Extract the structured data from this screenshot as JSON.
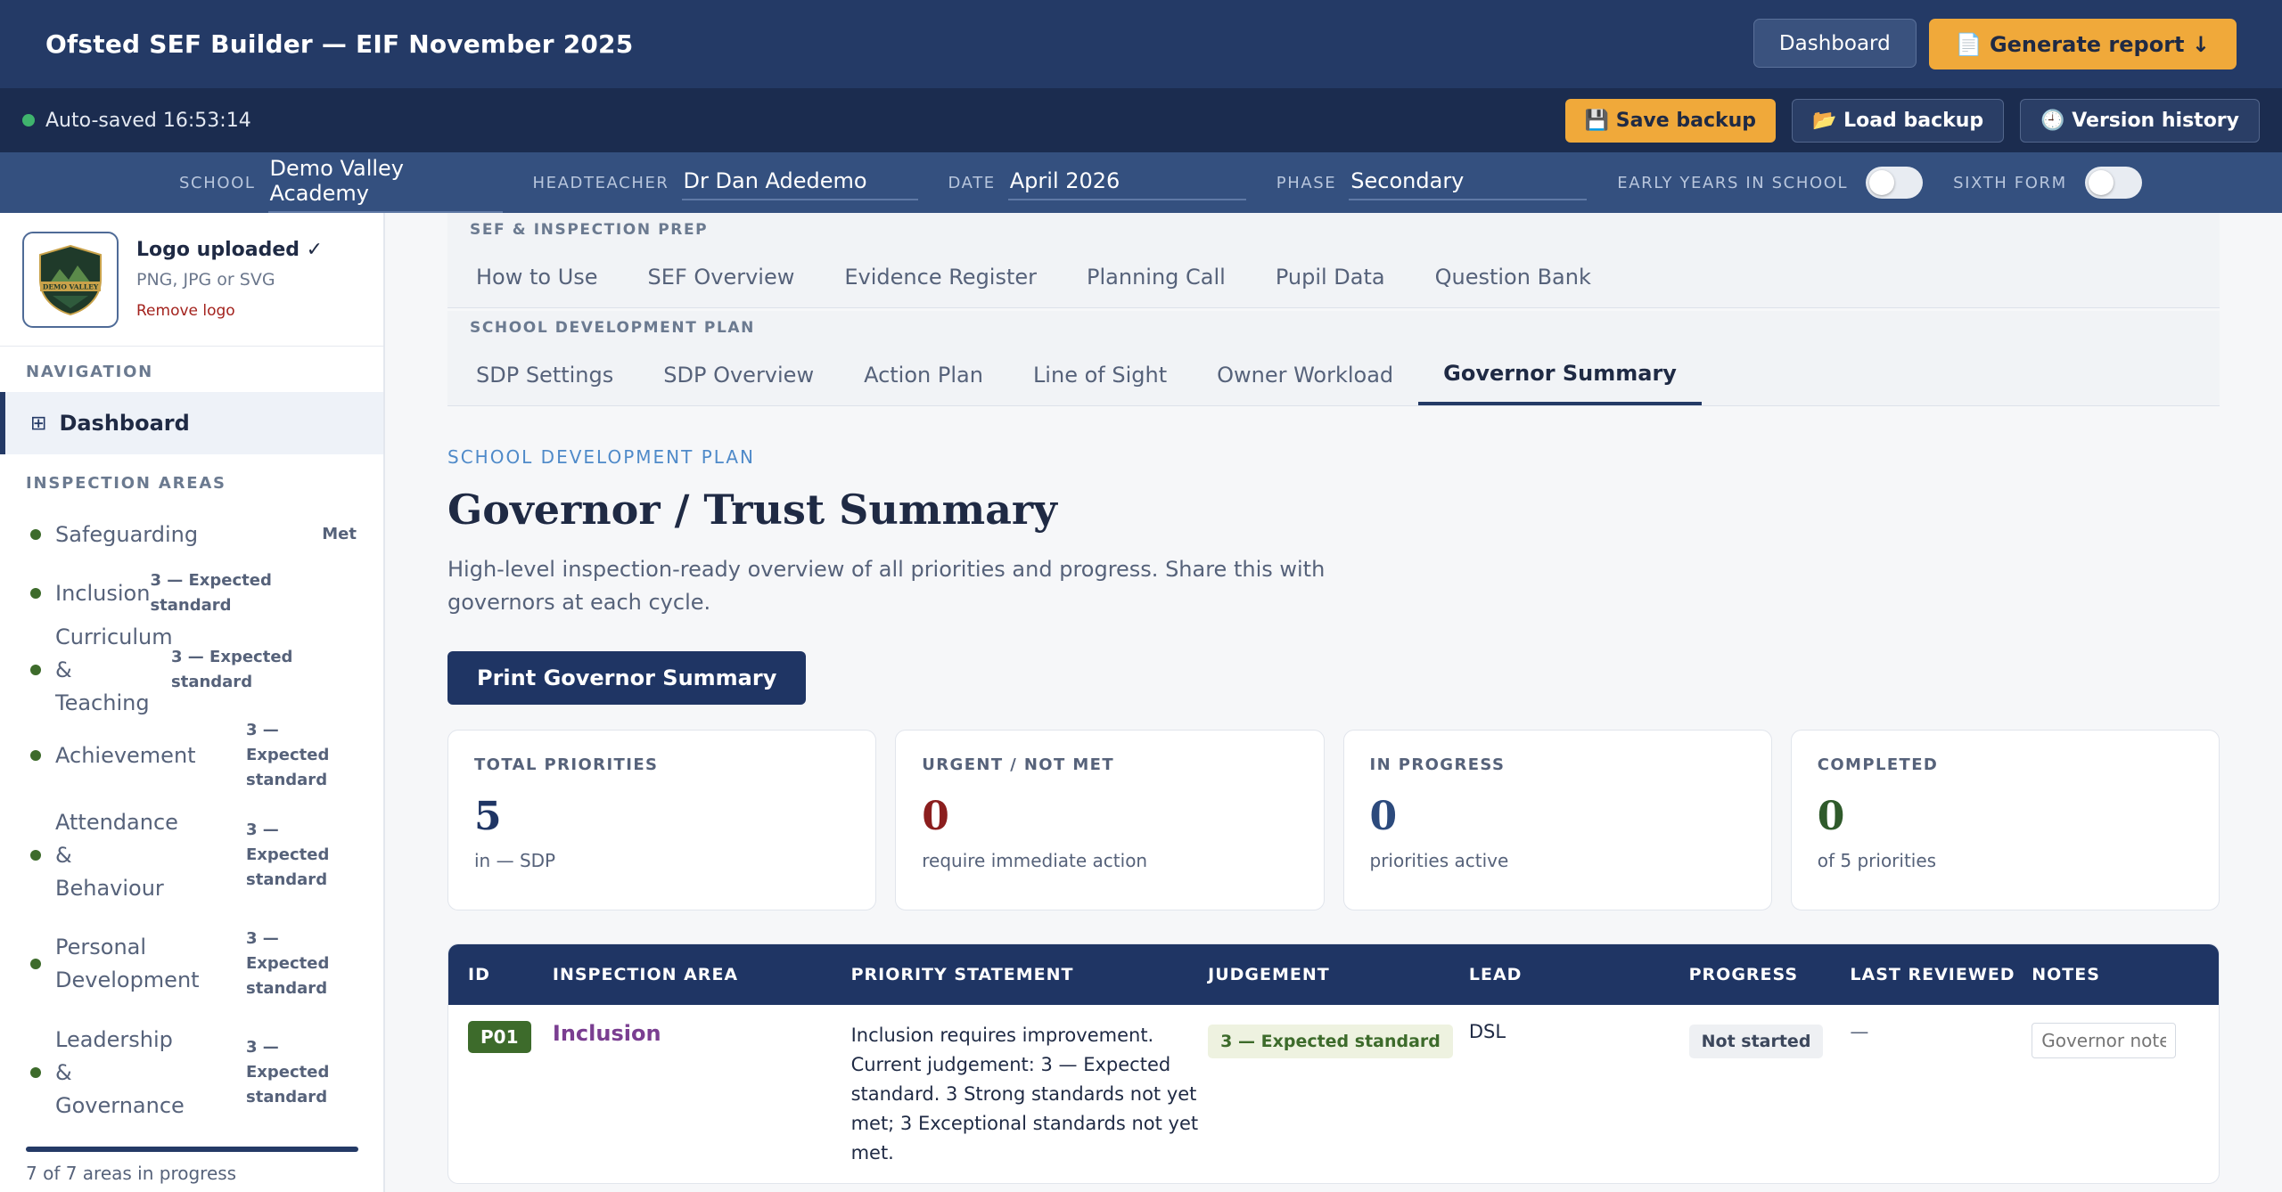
{
  "header": {
    "title": "Ofsted SEF Builder — EIF November 2025",
    "dashboard_label": "Dashboard",
    "generate_label": "📄 Generate report ↓"
  },
  "savebar": {
    "status": "Auto-saved 16:53:14",
    "save_backup": "💾 Save backup",
    "load_backup": "📂 Load backup",
    "version_history": "🕘 Version history"
  },
  "school_info": {
    "school_label": "SCHOOL",
    "school": "Demo Valley Academy",
    "headteacher_label": "HEADTEACHER",
    "headteacher": "Dr Dan Adedemo",
    "date_label": "DATE",
    "date": "April 2026",
    "phase_label": "PHASE",
    "phase": "Secondary",
    "early_years_label": "EARLY YEARS IN SCHOOL",
    "sixth_form_label": "SIXTH FORM"
  },
  "sidebar": {
    "logo_status": "Logo uploaded ✓",
    "logo_hint": "PNG, JPG or SVG",
    "logo_remove": "Remove logo",
    "logo_text": "DEMO VALLEY",
    "navigation_heading": "NAVIGATION",
    "dashboard_label": "Dashboard",
    "areas_heading": "INSPECTION AREAS",
    "areas": [
      {
        "name": "Safeguarding",
        "judgement": "Met"
      },
      {
        "name": "Inclusion",
        "judgement": "3 — Expected standard"
      },
      {
        "name": "Curriculum & Teaching",
        "judgement": "3 — Expected standard"
      },
      {
        "name": "Achievement",
        "judgement": "3 — Expected standard"
      },
      {
        "name": "Attendance & Behaviour",
        "judgement": "3 — Expected standard"
      },
      {
        "name": "Personal Development",
        "judgement": "3 — Expected standard"
      },
      {
        "name": "Leadership & Governance",
        "judgement": "3 — Expected standard"
      }
    ],
    "progress_fraction": 1.0,
    "progress_text": "7 of 7 areas in progress"
  },
  "tabs": {
    "group1_label": "SEF & INSPECTION PREP",
    "group1": [
      "How to Use",
      "SEF Overview",
      "Evidence Register",
      "Planning Call",
      "Pupil Data",
      "Question Bank"
    ],
    "group2_label": "SCHOOL DEVELOPMENT PLAN",
    "group2": [
      "SDP Settings",
      "SDP Overview",
      "Action Plan",
      "Line of Sight",
      "Owner Workload",
      "Governor Summary"
    ],
    "active": "Governor Summary"
  },
  "main": {
    "kicker": "SCHOOL DEVELOPMENT PLAN",
    "title": "Governor / Trust Summary",
    "description": "High-level inspection-ready overview of all priorities and progress. Share this with governors at each cycle.",
    "print_label": "Print Governor Summary"
  },
  "stats": [
    {
      "label": "TOTAL PRIORITIES",
      "value": "5",
      "sub": "in — SDP",
      "color": "#1f3564"
    },
    {
      "label": "URGENT / NOT MET",
      "value": "0",
      "sub": "require immediate action",
      "color": "#8b1e1e"
    },
    {
      "label": "IN PROGRESS",
      "value": "0",
      "sub": "priorities active",
      "color": "#2c4a7c"
    },
    {
      "label": "COMPLETED",
      "value": "0",
      "sub": "of 5 priorities",
      "color": "#2f5a2b"
    }
  ],
  "table": {
    "headers": [
      "ID",
      "INSPECTION AREA",
      "PRIORITY STATEMENT",
      "JUDGEMENT",
      "LEAD",
      "PROGRESS",
      "LAST REVIEWED",
      "NOTES"
    ],
    "rows": [
      {
        "id": "P01",
        "area": "Inclusion",
        "statement": "Inclusion requires improvement. Current judgement: 3 — Expected standard. 3 Strong standards not yet met; 3 Exceptional standards not yet met.",
        "judgement": "3 — Expected standard",
        "lead": "DSL",
        "progress": "Not started",
        "last_reviewed": "—",
        "notes_placeholder": "Governor notes"
      }
    ]
  }
}
